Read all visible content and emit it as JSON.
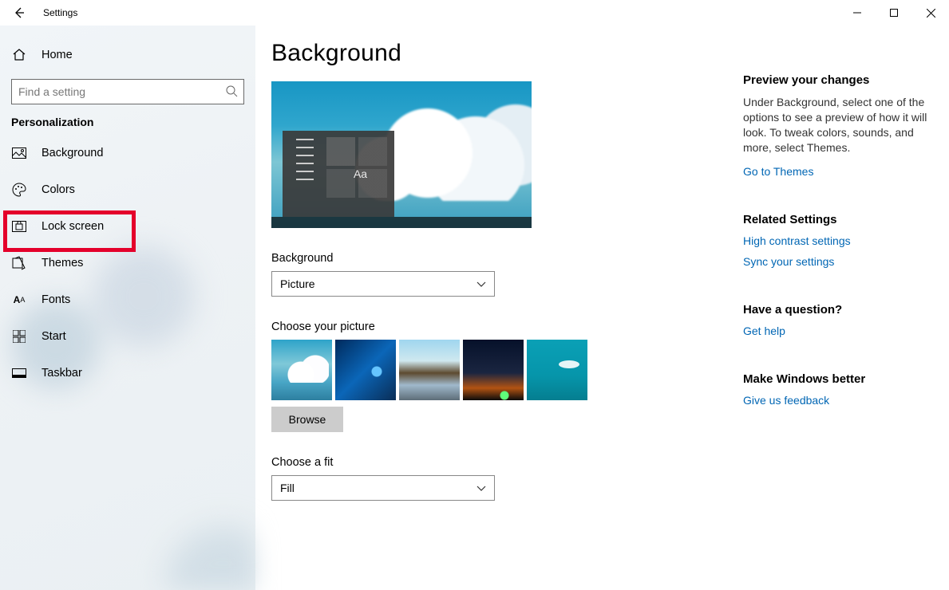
{
  "app_title": "Settings",
  "sidebar": {
    "home": "Home",
    "search_placeholder": "Find a setting",
    "category": "Personalization",
    "items": [
      {
        "label": "Background"
      },
      {
        "label": "Colors"
      },
      {
        "label": "Lock screen"
      },
      {
        "label": "Themes"
      },
      {
        "label": "Fonts"
      },
      {
        "label": "Start"
      },
      {
        "label": "Taskbar"
      }
    ]
  },
  "main": {
    "heading": "Background",
    "preview_sample_text": "Aa",
    "background_label": "Background",
    "background_value": "Picture",
    "choose_picture_label": "Choose your picture",
    "browse_label": "Browse",
    "fit_label": "Choose a fit",
    "fit_value": "Fill"
  },
  "right": {
    "preview_head": "Preview your changes",
    "preview_text": "Under Background, select one of the options to see a preview of how it will look. To tweak colors, sounds, and more, select Themes.",
    "themes_link": "Go to Themes",
    "related_head": "Related Settings",
    "related_links": [
      "High contrast settings",
      "Sync your settings"
    ],
    "question_head": "Have a question?",
    "help_link": "Get help",
    "better_head": "Make Windows better",
    "feedback_link": "Give us feedback"
  }
}
